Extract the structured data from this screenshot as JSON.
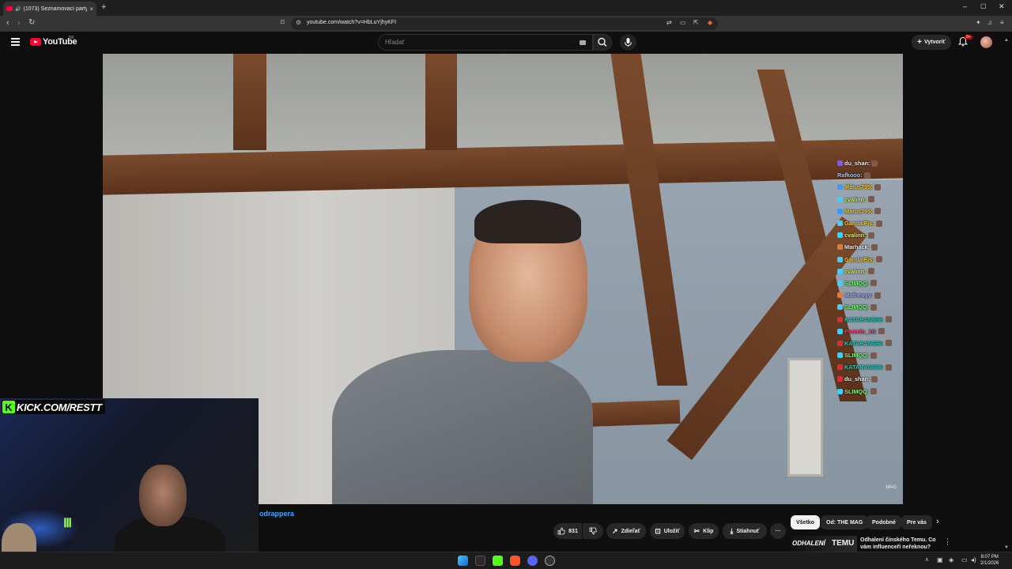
{
  "browser": {
    "tab_title": "(1073) Seznamovací party s...",
    "tab_close": "×",
    "new_tab": "+",
    "url": "youtube.com/watch?v=HbLuYjhyKFI",
    "window_controls": [
      "–",
      "▢",
      "✕"
    ]
  },
  "youtube": {
    "logo_text": "YouTube",
    "country_code": "SK",
    "search_placeholder": "Hľadať",
    "create_label": "Vytvoriť",
    "notification_count": "9+"
  },
  "video": {
    "watermark": "MAG"
  },
  "chat": [
    {
      "user": "du_shan:",
      "color": "#f5f5f5",
      "badge": "#7a5aff"
    },
    {
      "user": "Rafkooo:",
      "color": "#a8c8ff",
      "badge": null
    },
    {
      "user": "Matus795:",
      "color": "#ffd23a",
      "badge": "#3a9aff"
    },
    {
      "user": "cvalinn:",
      "color": "#d7ff4a",
      "badge": "#3ad0ff"
    },
    {
      "user": "Matus795:",
      "color": "#ffd23a",
      "badge": "#3a9aff"
    },
    {
      "user": "GandalFis:",
      "color": "#ffd23a",
      "badge": "#3ad0ff"
    },
    {
      "user": "cvalinn:",
      "color": "#d7ff4a",
      "badge": "#3ad0ff"
    },
    {
      "user": "Marhack:",
      "color": "#f0f0f0",
      "badge": "#e07a3a"
    },
    {
      "user": "GandalFis:",
      "color": "#ffd23a",
      "badge": "#3ad0ff"
    },
    {
      "user": "cvalinn:",
      "color": "#d7ff4a",
      "badge": "#3ad0ff"
    },
    {
      "user": "SLIMQQ:",
      "color": "#7aff7a",
      "badge": "#3ad0ff"
    },
    {
      "user": "Mathenyy:",
      "color": "#b0b0ff",
      "badge": "#e07a3a"
    },
    {
      "user": "SLIMQQ:",
      "color": "#7aff7a",
      "badge": "#3ad0ff"
    },
    {
      "user": "KATARAN666:",
      "color": "#2fd0c0",
      "badge": "#e02a3a"
    },
    {
      "user": "Pomelo_18:",
      "color": "#ff4a7a",
      "badge": "#3ad0ff"
    },
    {
      "user": "KATARAN666:",
      "color": "#2fd0c0",
      "badge": "#e02a3a"
    },
    {
      "user": "SLIMQQ:",
      "color": "#7aff7a",
      "badge": "#3ad0ff"
    },
    {
      "user": "KATARAN666:",
      "color": "#2fd0c0",
      "badge": "#e02a3a"
    },
    {
      "user": "du_shan:",
      "color": "#f5f5f5",
      "badge": "#e02a3a"
    },
    {
      "user": "SLIMQQ:",
      "color": "#7aff7a",
      "badge": "#3ad0ff"
    }
  ],
  "webcam": {
    "kick_letter": "K",
    "kick_text": "KICK.COM/RESTT"
  },
  "below_video": {
    "channel_link_text": "odrappera",
    "like_count": "831",
    "share_label": "Zdieľať",
    "save_label": "Uložiť",
    "clip_label": "Klip",
    "download_label": "Stiahnuť",
    "more_label": "···"
  },
  "chips": [
    "Všetko",
    "Od: THE MAG",
    "Podobné",
    "Pre vás"
  ],
  "recommendation": {
    "thumb_text_1": "ODHALENÍ",
    "thumb_text_2": "TEMU",
    "title": "Odhalení čínského Temu. Co vám influenceři neřeknou?"
  },
  "taskbar": {
    "time": "8:07 PM",
    "date": "2/1/2026"
  }
}
